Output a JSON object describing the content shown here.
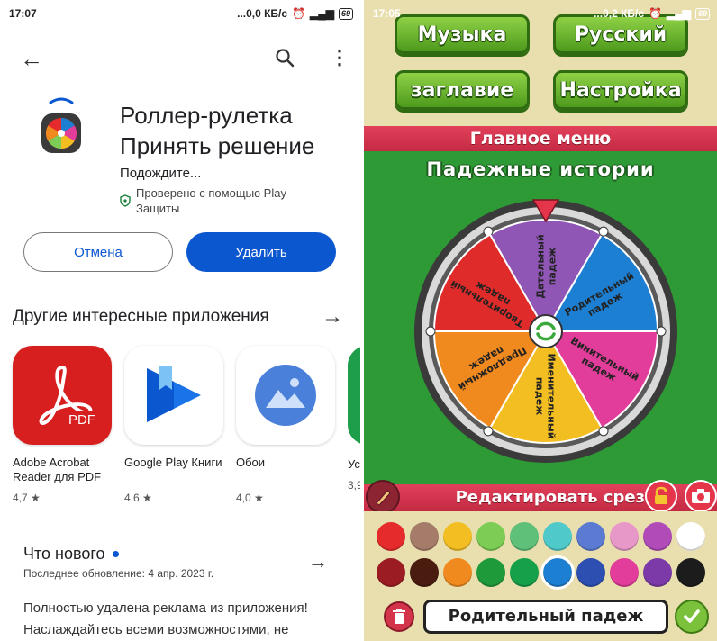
{
  "left": {
    "status": {
      "time": "17:07",
      "net": "...0,0 КБ/с",
      "battery": "69"
    },
    "app": {
      "title": "Роллер-рулетка Принять решение",
      "status": "Подождите...",
      "verified": "Проверено с помощью Play Защиты"
    },
    "buttons": {
      "cancel": "Отмена",
      "delete": "Удалить"
    },
    "section_title": "Другие интересные приложения",
    "apps": [
      {
        "name": "Adobe Acrobat Reader для PDF",
        "rating": "4,7 ★",
        "icon": "pdf-icon"
      },
      {
        "name": "Google Play Книги",
        "rating": "4,6 ★",
        "icon": "play-books-icon"
      },
      {
        "name": "Обои",
        "rating": "4,0 ★",
        "icon": "wallpapers-icon"
      },
      {
        "name": "Ус",
        "rating": "3,9"
      }
    ],
    "whats_new": {
      "title": "Что нового",
      "updated": "Последнее обновление: 4 апр. 2023 г.",
      "desc": "Полностью удалена реклама из приложения! Наслаждайтесь всеми возможностями, не"
    }
  },
  "right": {
    "status": {
      "time": "17:05",
      "net": "...0,2 КБ/с",
      "battery": "69"
    },
    "buttons": {
      "music": "Музыка",
      "russian": "Русский",
      "title": "заглавие",
      "settings": "Настройка"
    },
    "main_menu": "Главное меню",
    "game_title": "Падежные истории",
    "wheel": {
      "segments": [
        {
          "label": "Дательный падеж",
          "color": "#8f56b5"
        },
        {
          "label": "Родительный падеж",
          "color": "#1d7fd2"
        },
        {
          "label": "Винительный падеж",
          "color": "#e23d9a"
        },
        {
          "label": "Именительный падеж",
          "color": "#f3be22"
        },
        {
          "label": "Предложный падеж",
          "color": "#f18a1e"
        },
        {
          "label": "Творительный падеж",
          "color": "#e02b2b"
        }
      ]
    },
    "edit_label": "Редактировать срез",
    "palette": [
      "#e52b2b",
      "#a57c6a",
      "#f3be22",
      "#7ccc55",
      "#5fc07a",
      "#4fc9c9",
      "#5b7ad1",
      "#e897c9",
      "#b04bb8",
      "#ffffff",
      "#9b1c22",
      "#4a1c10",
      "#f18a1e",
      "#1f9a3b",
      "#17a04a",
      "#1d7fd2",
      "#2d4fb2",
      "#e23d9a",
      "#7b3aa8",
      "#1c1c1c"
    ],
    "selected_name": "Родительный падеж"
  }
}
